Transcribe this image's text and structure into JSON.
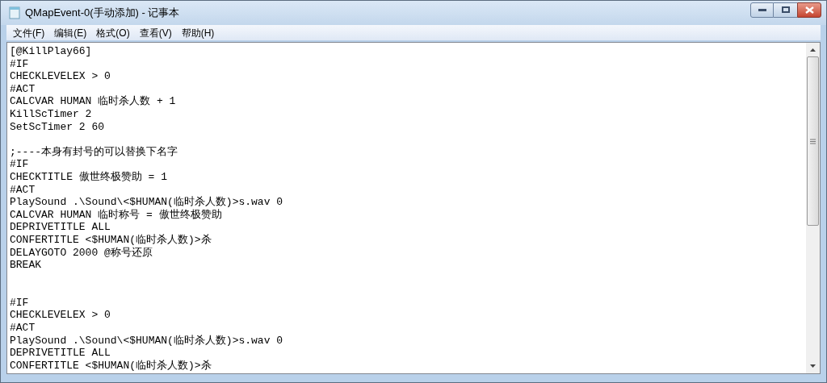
{
  "window": {
    "title": "QMapEvent-0(手动添加) - 记事本"
  },
  "menu": [
    "文件(F)",
    "编辑(E)",
    "格式(O)",
    "查看(V)",
    "帮助(H)"
  ],
  "editor": {
    "text": "[@KillPlay66]\n#IF\nCHECKLEVELEX > 0\n#ACT\nCALCVAR HUMAN 临时杀人数 + 1\nKillScTimer 2\nSetScTimer 2 60\n\n;----本身有封号的可以替换下名字\n#IF\nCHECKTITLE 傲世终极赞助 = 1\n#ACT\nPlaySound .\\Sound\\<$HUMAN(临时杀人数)>s.wav 0\nCALCVAR HUMAN 临时称号 = 傲世终极赞助\nDEPRIVETITLE ALL\nCONFERTITLE <$HUMAN(临时杀人数)>杀\nDELAYGOTO 2000 @称号还原\nBREAK\n\n\n#IF\nCHECKLEVELEX > 0\n#ACT\nPlaySound .\\Sound\\<$HUMAN(临时杀人数)>s.wav 0\nDEPRIVETITLE ALL\nCONFERTITLE <$HUMAN(临时杀人数)>杀"
  }
}
